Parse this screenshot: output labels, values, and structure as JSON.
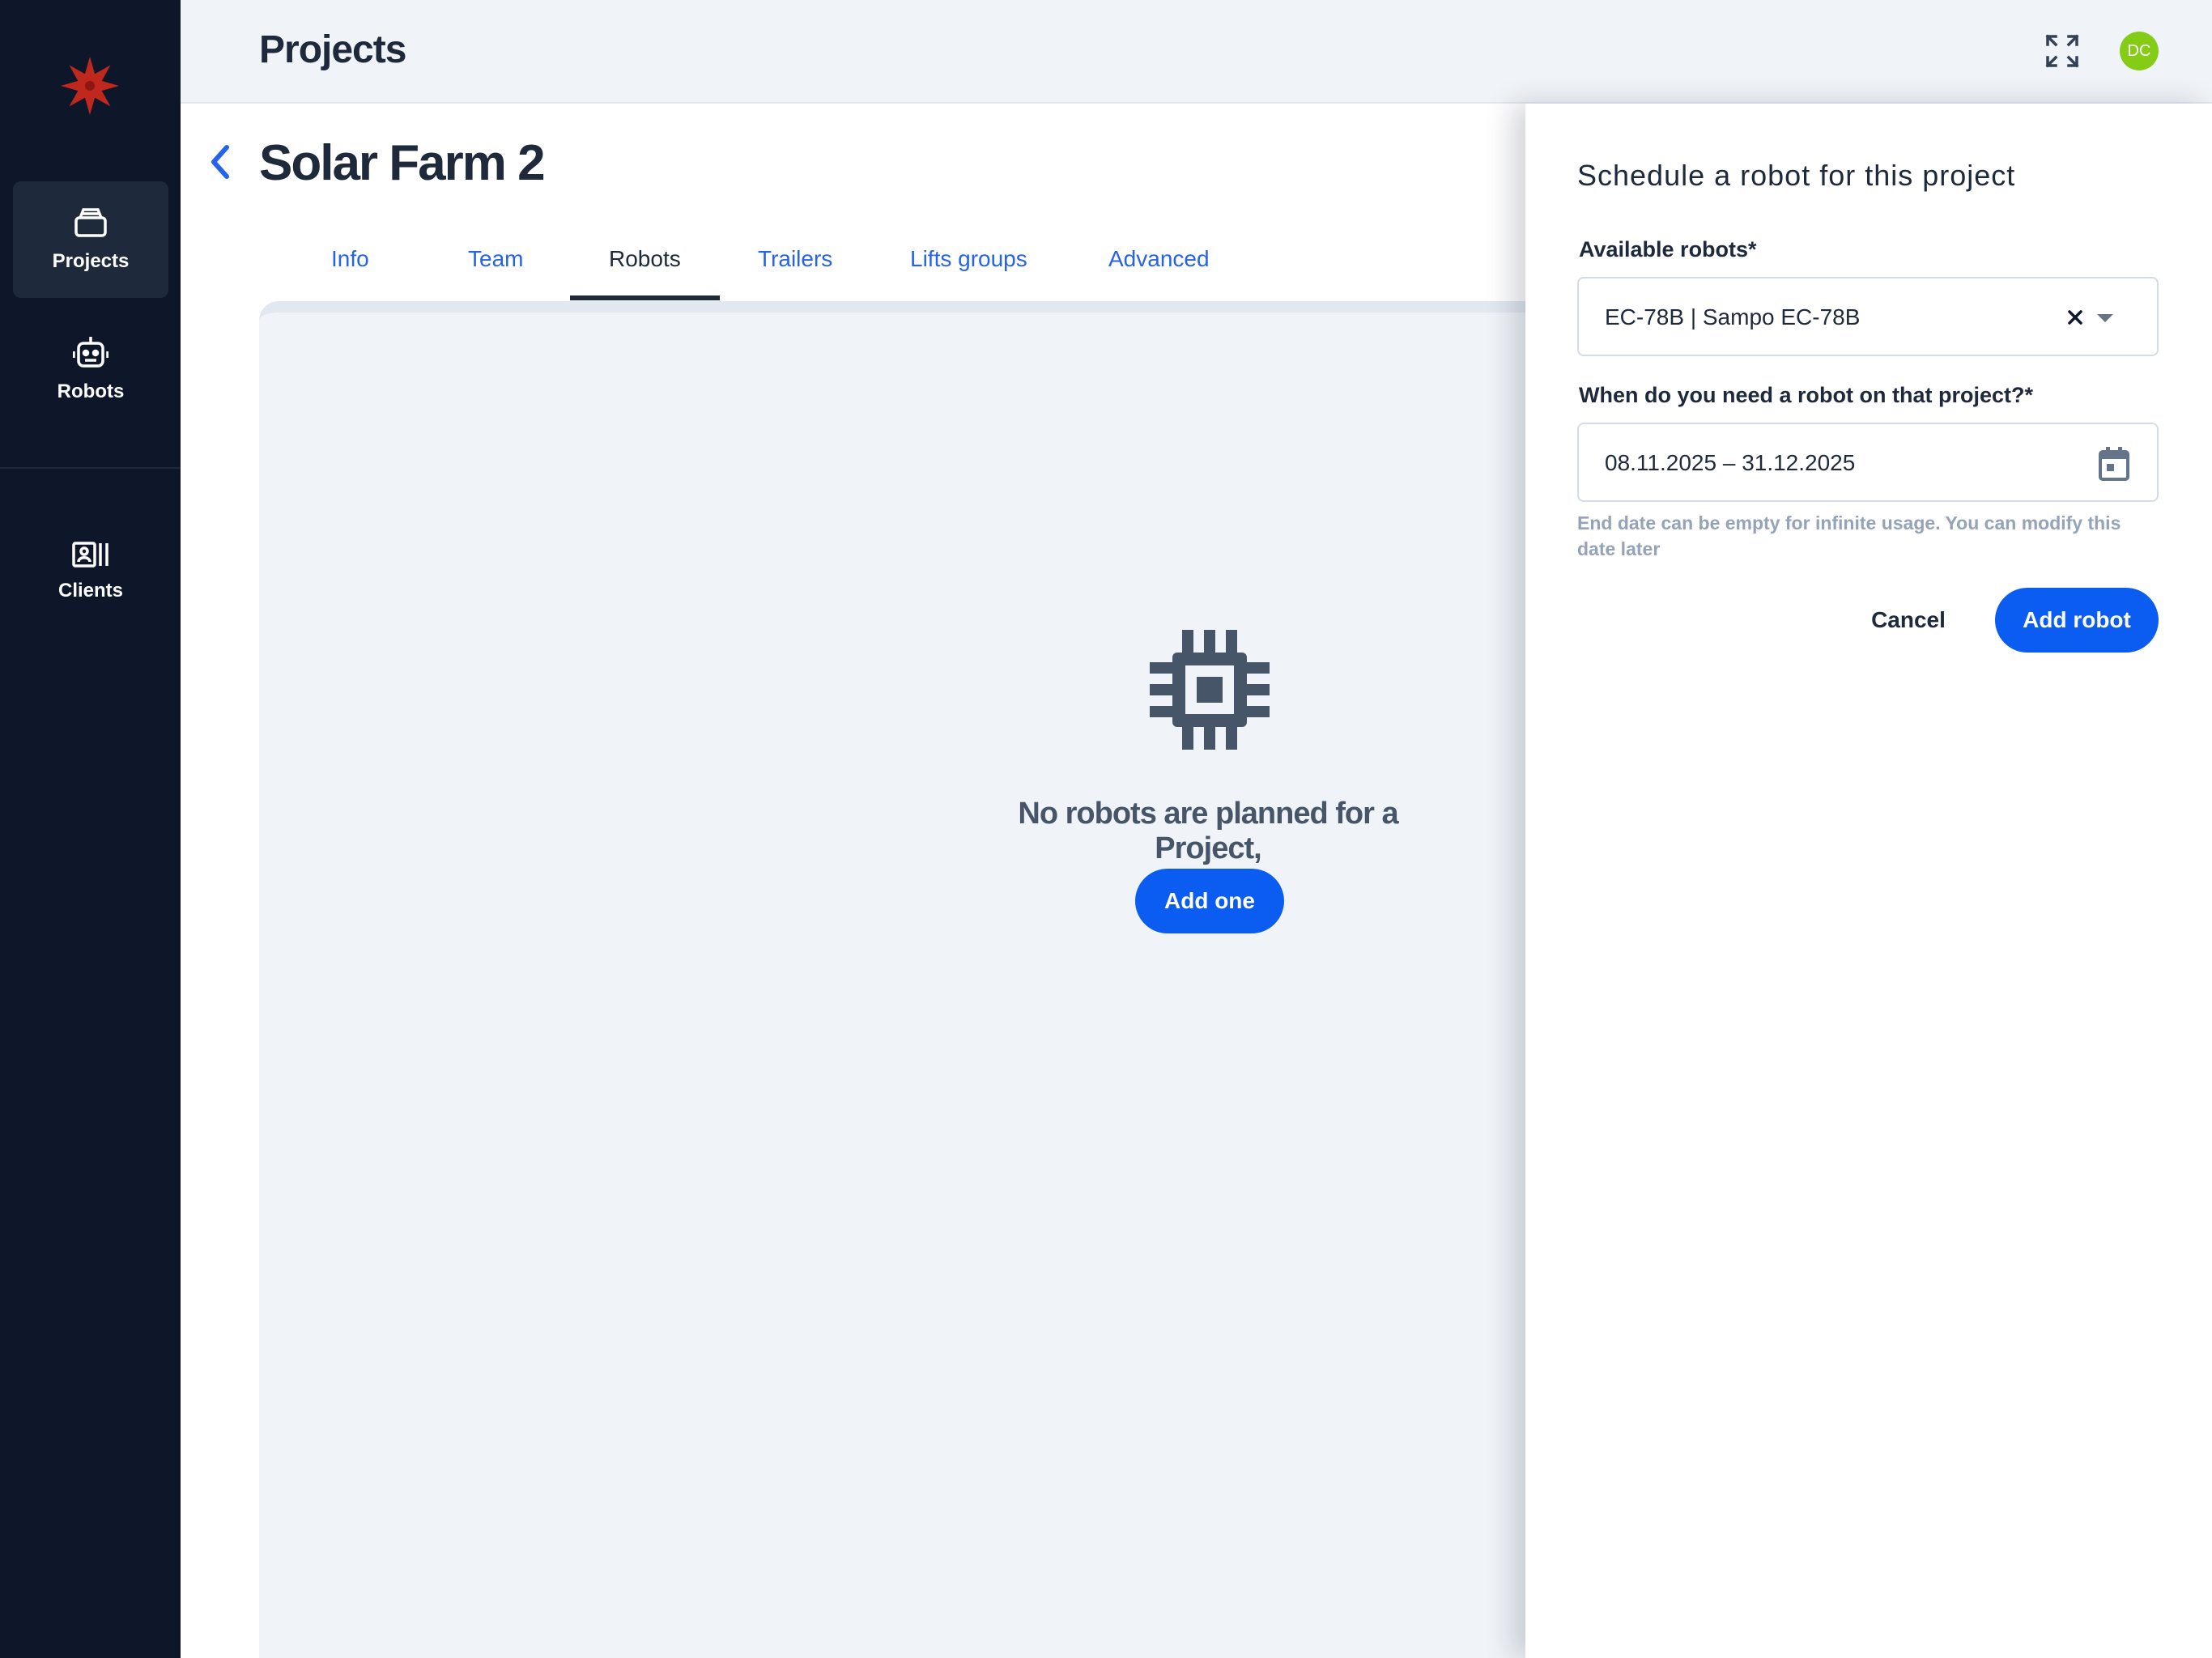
{
  "app": {
    "header_title": "Projects",
    "avatar_initials": "DC"
  },
  "sidebar": {
    "items": [
      {
        "label": "Projects",
        "icon": "projects-icon",
        "active": true
      },
      {
        "label": "Robots",
        "icon": "robot-icon",
        "active": false
      },
      {
        "label": "Clients",
        "icon": "clients-icon",
        "active": false
      }
    ]
  },
  "project": {
    "title": "Solar Farm 2",
    "tabs": [
      {
        "label": "Info"
      },
      {
        "label": "Team"
      },
      {
        "label": "Robots",
        "active": true
      },
      {
        "label": "Trailers"
      },
      {
        "label": "Lifts groups"
      },
      {
        "label": "Advanced"
      }
    ],
    "empty_message": "No robots are planned for a Project,",
    "add_one_label": "Add one"
  },
  "drawer": {
    "title": "Schedule a robot for this project",
    "robot_label": "Available robots*",
    "robot_value": "EC-78B | Sampo EC-78B",
    "date_label": "When do you need a robot on that project?*",
    "date_value": "08.11.2025 – 31.12.2025",
    "helper_text": "End date can be empty for infinite usage. You can modify this date later",
    "cancel_label": "Cancel",
    "submit_label": "Add robot"
  },
  "colors": {
    "sidebar_bg": "#0e172a",
    "accent": "#0b5cf0",
    "link": "#2563eb",
    "avatar": "#84cc16",
    "logo": "#c0281e"
  }
}
